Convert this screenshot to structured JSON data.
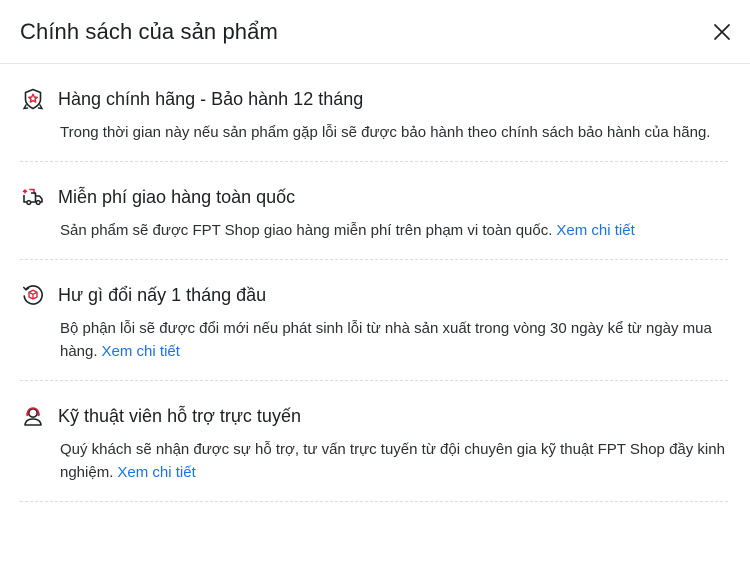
{
  "header": {
    "title": "Chính sách của sản phẩm",
    "close_icon": "close-icon"
  },
  "colors": {
    "link": "#1a73e8",
    "icon_accent": "#e0203a",
    "icon_stroke": "#1f2328",
    "divider": "#d9dce0"
  },
  "items": [
    {
      "icon": "genuine-badge-icon",
      "title": "Hàng chính hãng - Bảo hành 12 tháng",
      "desc": "Trong thời gian này nếu sản phẩm gặp lỗi sẽ được bảo hành theo chính sách bảo hành của hãng.",
      "link": ""
    },
    {
      "icon": "delivery-truck-icon",
      "title": "Miễn phí giao hàng toàn quốc",
      "desc": "Sản phẩm sẽ được FPT Shop giao hàng miễn phí trên phạm vi toàn quốc.",
      "link": "Xem chi tiết"
    },
    {
      "icon": "exchange-box-icon",
      "title": "Hư gì đổi nấy 1 tháng đầu",
      "desc": "Bộ phận lỗi sẽ được đổi mới nếu phát sinh lỗi từ nhà sản xuất trong vòng 30 ngày kể từ ngày mua hàng.",
      "link": "Xem chi tiết"
    },
    {
      "icon": "support-agent-icon",
      "title": "Kỹ thuật viên hỗ trợ trực tuyến",
      "desc": "Quý khách sẽ nhận được sự hỗ trợ, tư vấn trực tuyến từ đội chuyên gia kỹ thuật FPT Shop đầy kinh nghiệm.",
      "link": "Xem chi tiết"
    }
  ]
}
